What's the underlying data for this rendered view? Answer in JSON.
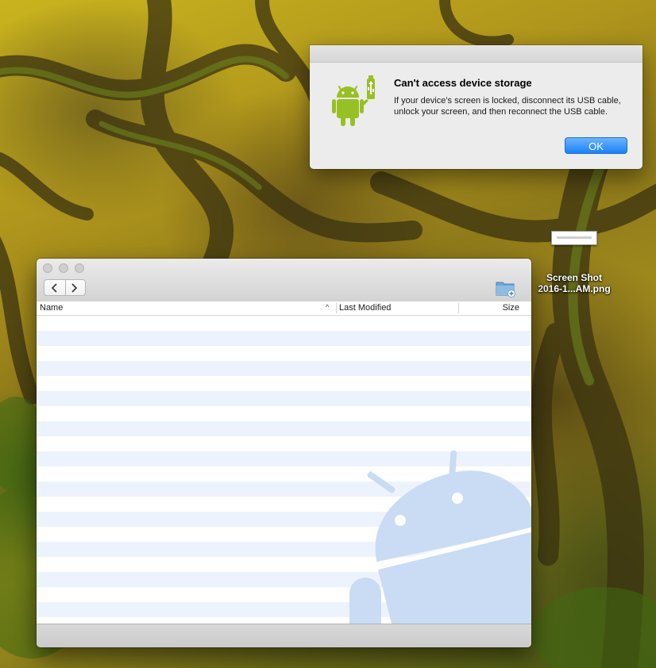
{
  "desktop": {
    "file_icon": {
      "icon": "image-file-icon",
      "label_line1": "Screen Shot",
      "label_line2": "2016-1...AM.png"
    }
  },
  "alert": {
    "icon": "android-usb-icon",
    "title": "Can't access device storage",
    "message": "If your device's screen is locked, disconnect its USB cable, unlock your screen, and then reconnect the USB cable.",
    "ok_label": "OK"
  },
  "file_window": {
    "traffic_lights": [
      "close-button",
      "minimize-button",
      "zoom-button"
    ],
    "nav": {
      "back_icon": "chevron-left-icon",
      "forward_icon": "chevron-right-icon"
    },
    "new_folder_icon": "new-folder-icon",
    "columns": {
      "name": "Name",
      "last_modified": "Last Modified",
      "size": "Size"
    },
    "sort_indicator": "^",
    "rows": [],
    "watermark_icon": "android-logo-icon"
  },
  "colors": {
    "accent_button": "#1a82fb",
    "android_green": "#97c024",
    "stripe_blue": "#edf3fc",
    "watermark_blue": "#c9dcf4"
  }
}
